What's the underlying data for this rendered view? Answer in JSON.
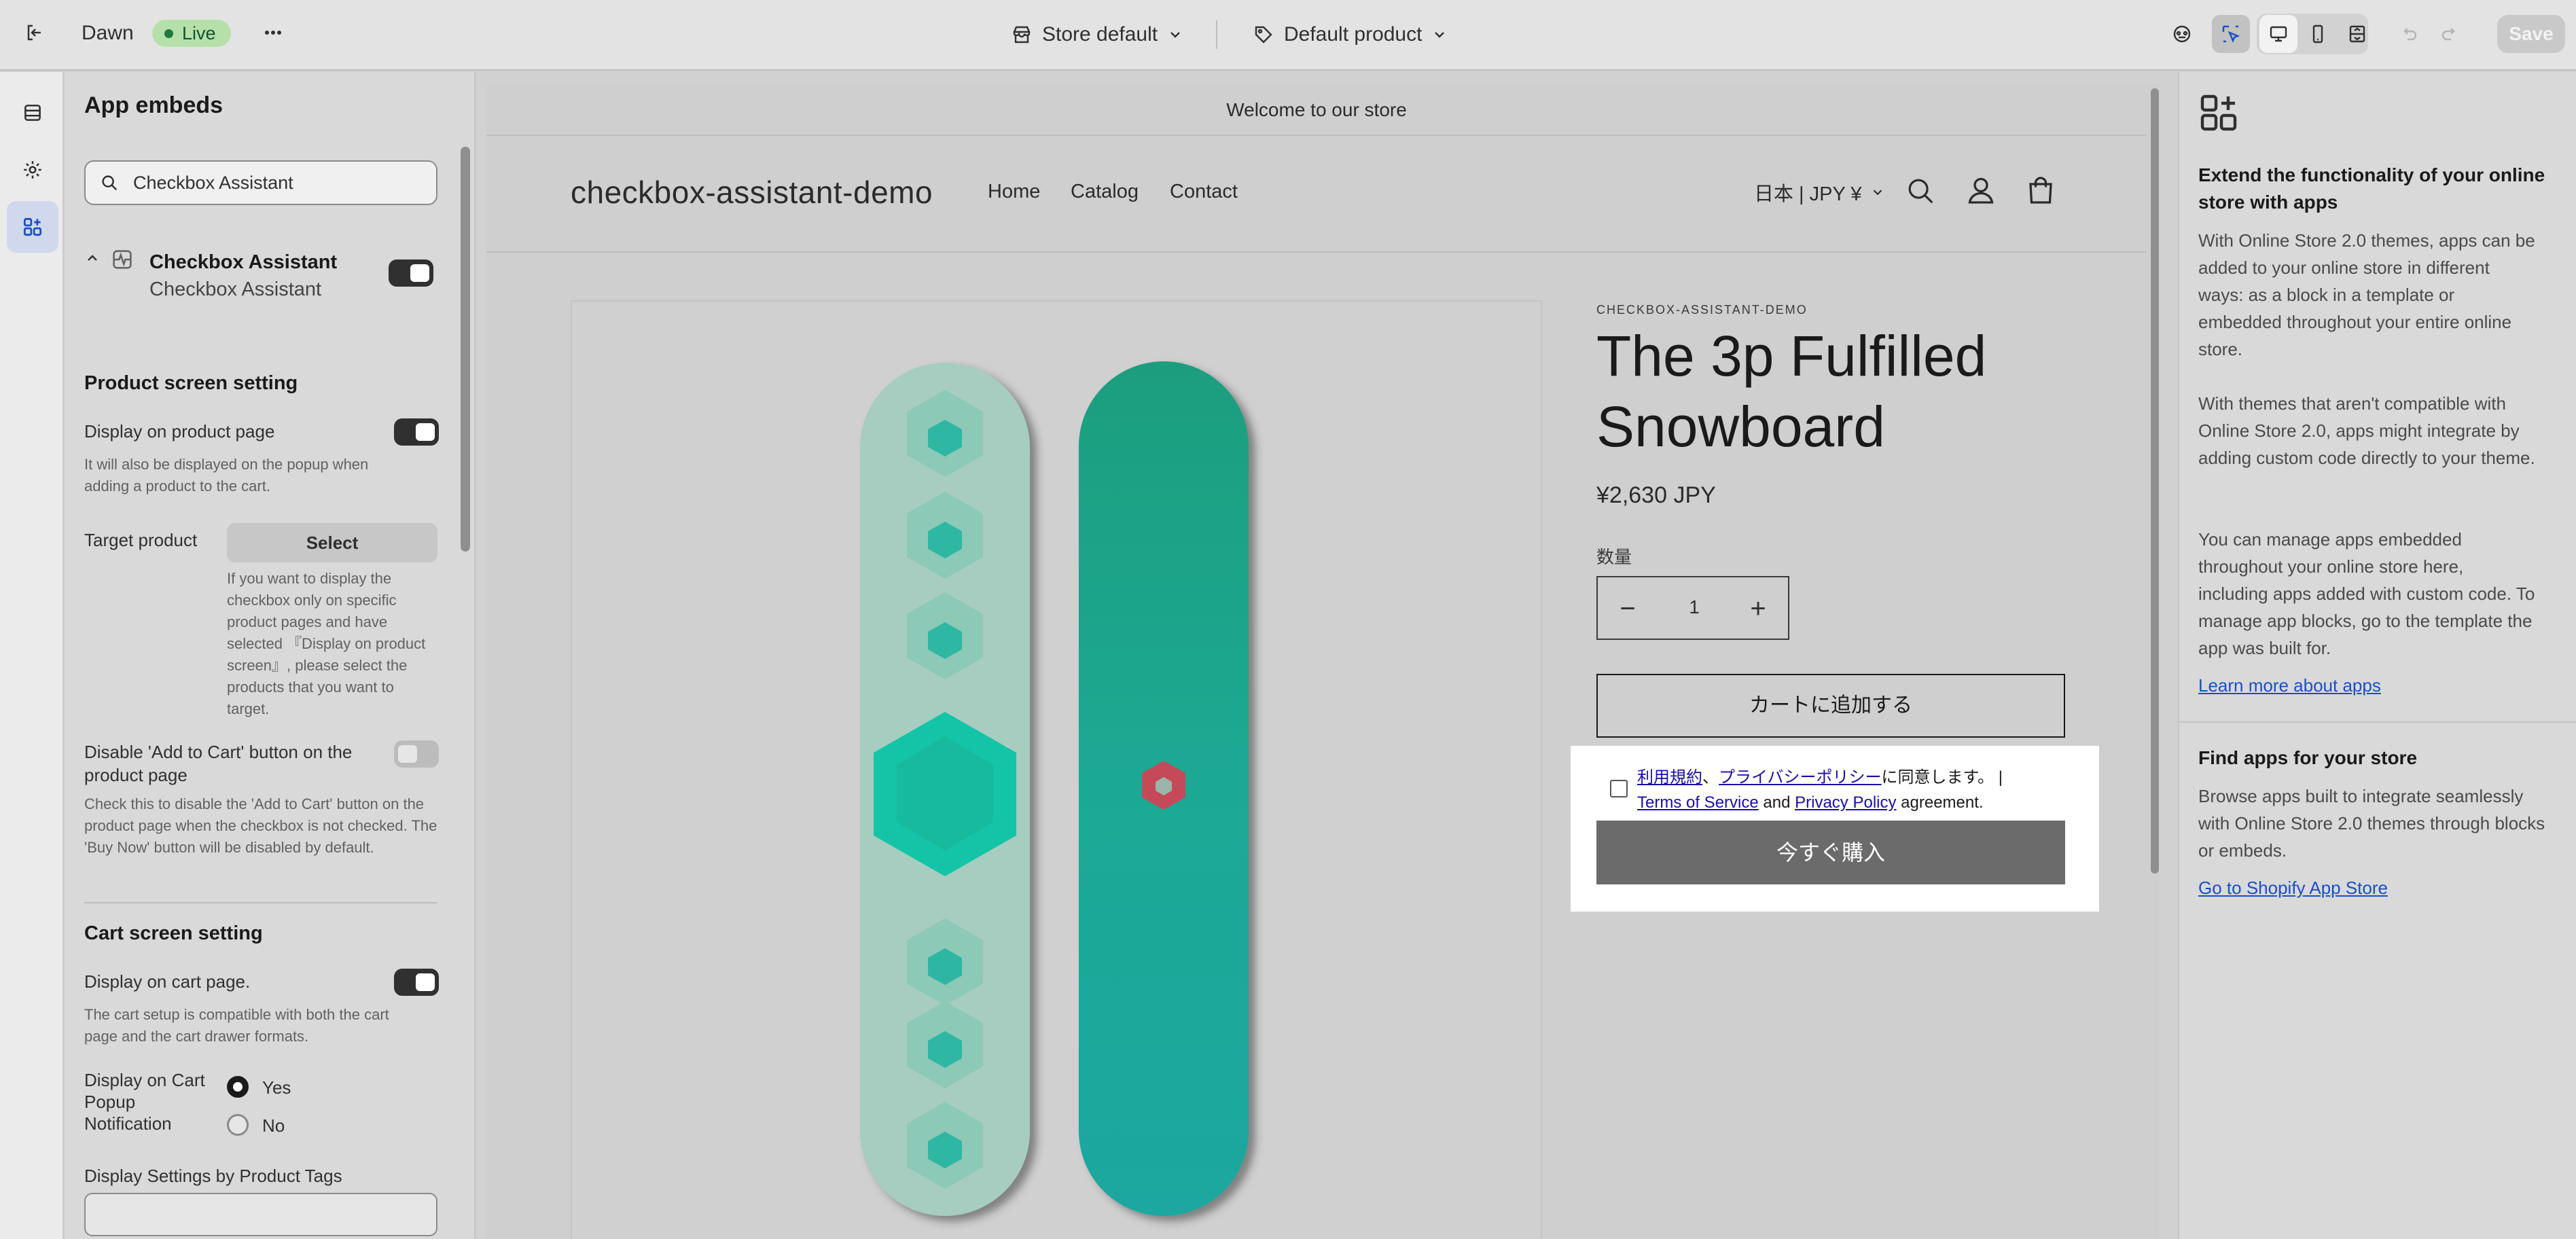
{
  "topbar": {
    "theme_name": "Dawn",
    "live_label": "Live",
    "store_selector": "Store default",
    "template_selector": "Default product",
    "save_label": "Save"
  },
  "panel": {
    "title": "App embeds",
    "search_value": "Checkbox Assistant",
    "app_name": "Checkbox Assistant",
    "app_subtitle": "Checkbox Assistant",
    "product_section_title": "Product screen setting",
    "display_product_label": "Display on product page",
    "display_product_help": "It will also be displayed on the popup when adding a product to the cart.",
    "target_product_label": "Target product",
    "select_label": "Select",
    "target_product_help": "If you want to display the checkbox only on specific product pages and have selected 『Display on product screen』, please select the products that you want to target.",
    "disable_cart_label": "Disable 'Add to Cart' button on the product page",
    "disable_cart_help": "Check this to disable the 'Add to Cart' button on the product page when the checkbox is not checked. The 'Buy Now' button will be disabled by default.",
    "cart_section_title": "Cart screen setting",
    "display_cart_label": "Display on cart page.",
    "display_cart_help": "The cart setup is compatible with both the cart page and the cart drawer formats.",
    "popup_label": "Display on Cart Popup Notification",
    "yes_label": "Yes",
    "no_label": "No",
    "tags_label": "Display Settings by Product Tags",
    "toggles": {
      "app_enabled": true,
      "display_product": true,
      "disable_cart": false,
      "display_cart": true
    },
    "popup_selected": "Yes"
  },
  "preview": {
    "announcement": "Welcome to our store",
    "store_name": "checkbox-assistant-demo",
    "nav": [
      "Home",
      "Catalog",
      "Contact"
    ],
    "currency": "日本 | JPY ¥",
    "vendor": "CHECKBOX-ASSISTANT-DEMO",
    "product_title": "The 3p Fulfilled Snowboard",
    "price": "¥2,630 JPY",
    "qty_label": "数量",
    "qty_minus": "−",
    "qty_value": "1",
    "qty_plus": "+",
    "add_to_cart": "カートに追加する",
    "consent_link_terms_jp": "利用規約",
    "consent_sep_jp": "、",
    "consent_link_privacy_jp": "プライバシーポリシー",
    "consent_tail_jp": "に同意します。 |",
    "consent_link_terms_en": "Terms of Service",
    "consent_and": " and ",
    "consent_link_privacy_en": "Privacy Policy",
    "consent_tail_en": " agreement.",
    "buy_now": "今すぐ購入",
    "colors": {
      "board_left": "#a5cfc1",
      "board_right": "#1a9e7e",
      "accent_hex": "#18b79a",
      "logo_red": "#c44a5a"
    }
  },
  "help": {
    "extend_title": "Extend the functionality of your online store with apps",
    "p1": "With Online Store 2.0 themes, apps can be added to your online store in different ways: as a block in a template or embedded throughout your entire online store.",
    "p2": "With themes that aren't compatible with Online Store 2.0, apps might integrate by adding custom code directly to your theme.",
    "p3": "You can manage apps embedded throughout your online store here, including apps added with custom code. To manage app blocks, go to the template the app was built for.",
    "learn_link": "Learn more about apps",
    "find_title": "Find apps for your store",
    "find_text": "Browse apps built to integrate seamlessly with Online Store 2.0 themes through blocks or embeds.",
    "store_link": "Go to Shopify App Store"
  }
}
